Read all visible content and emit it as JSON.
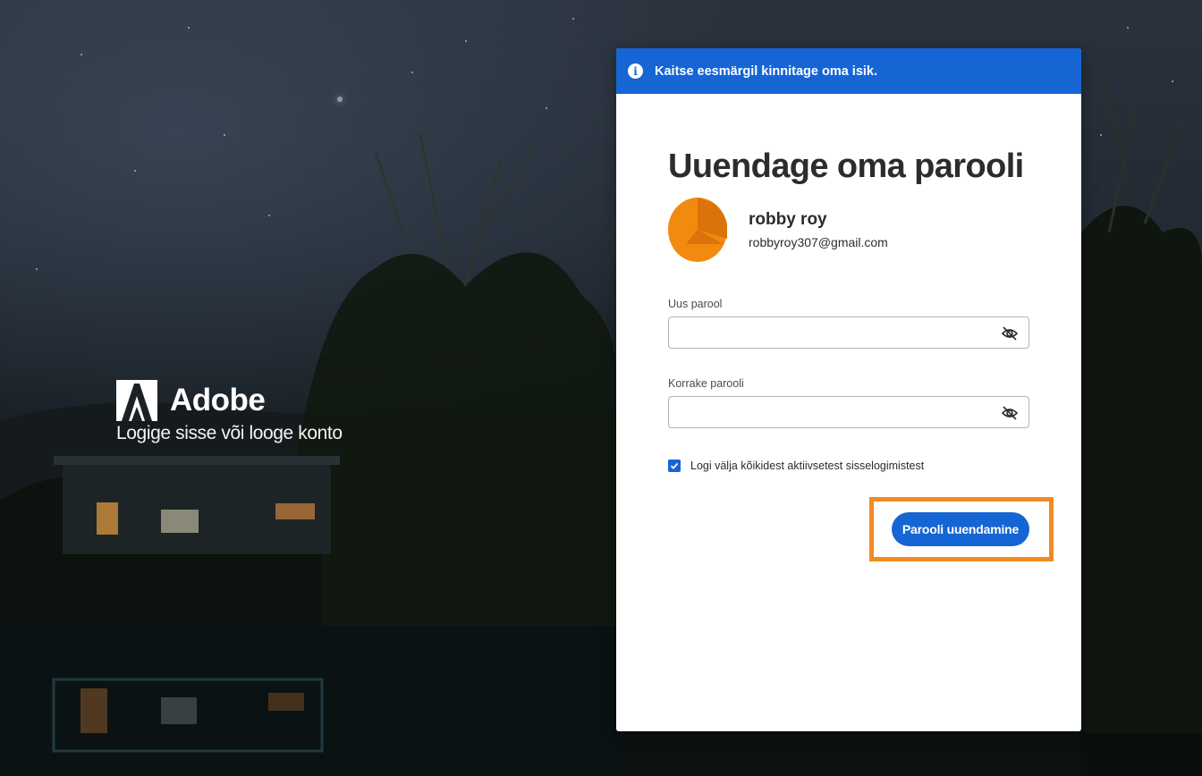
{
  "brand": {
    "name": "Adobe",
    "tagline": "Logige sisse või looge konto"
  },
  "banner": {
    "text": "Kaitse eesmärgil kinnitage oma isik.",
    "icon": "info-icon"
  },
  "form": {
    "title": "Uuendage oma parooli",
    "user": {
      "name": "robby roy",
      "email": "robbyroy307@gmail.com",
      "avatar_color": "#f28a0f"
    },
    "new_password": {
      "label": "Uus parool",
      "value": "",
      "icon": "eye-off-icon"
    },
    "confirm_password": {
      "label": "Korrake parooli",
      "value": "",
      "icon": "eye-off-icon"
    },
    "logout_all": {
      "label": "Logi välja kõikidest aktiivsetest sisselogimistest",
      "checked": true
    },
    "submit_label": "Parooli uuendamine"
  },
  "colors": {
    "accent": "#1565d4",
    "highlight": "#f28a24"
  }
}
